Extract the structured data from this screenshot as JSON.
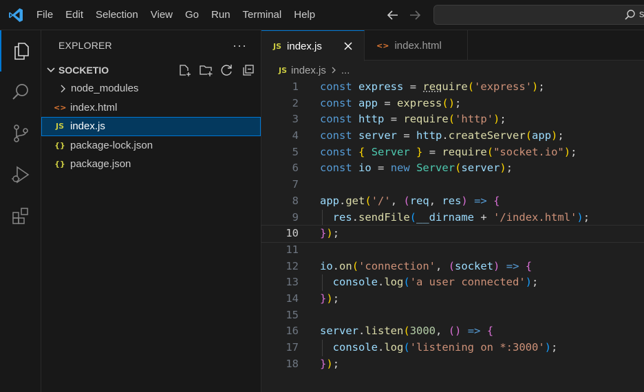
{
  "menu": [
    "File",
    "Edit",
    "Selection",
    "View",
    "Go",
    "Run",
    "Terminal",
    "Help"
  ],
  "search": {
    "text": "s"
  },
  "activity": [
    "explorer-icon",
    "search-icon",
    "source-control-icon",
    "run-debug-icon",
    "extensions-icon"
  ],
  "sidebar": {
    "title": "EXPLORER",
    "more": "···",
    "folder": "SOCKETIO",
    "items": [
      {
        "label": "node_modules",
        "icon": "›",
        "type": "folder"
      },
      {
        "label": "index.html",
        "icon": "<>",
        "type": "html"
      },
      {
        "label": "index.js",
        "icon": "JS",
        "type": "js",
        "selected": true
      },
      {
        "label": "package-lock.json",
        "icon": "{}",
        "type": "json"
      },
      {
        "label": "package.json",
        "icon": "{}",
        "type": "json"
      }
    ]
  },
  "tabs": [
    {
      "label": "index.js",
      "icon": "JS",
      "active": true
    },
    {
      "label": "index.html",
      "icon": "<>",
      "active": false
    }
  ],
  "breadcrumb": {
    "icon": "JS",
    "file": "index.js",
    "rest": "..."
  },
  "editor": {
    "current_line": 10,
    "lines": [
      "const express = require('express');",
      "const app = express();",
      "const http = require('http');",
      "const server = http.createServer(app);",
      "const { Server } = require(\"socket.io\");",
      "const io = new Server(server);",
      "",
      "app.get('/', (req, res) => {",
      "  res.sendFile(__dirname + '/index.html');",
      "});",
      "",
      "io.on('connection', (socket) => {",
      "  console.log('a user connected');",
      "});",
      "",
      "server.listen(3000, () => {",
      "  console.log('listening on *:3000');",
      "});"
    ]
  }
}
